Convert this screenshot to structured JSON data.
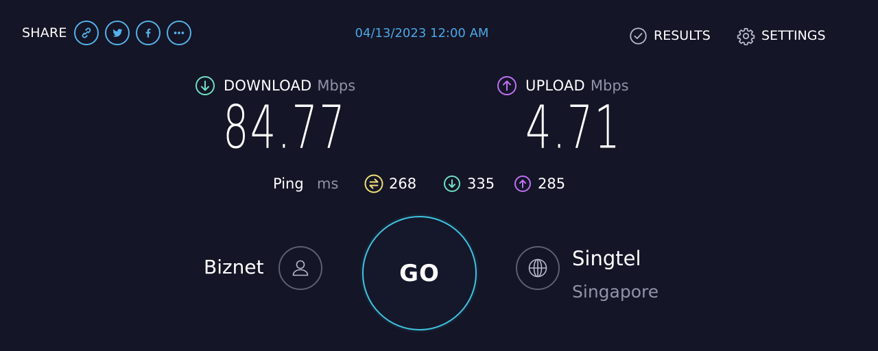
{
  "header": {
    "share_label": "SHARE",
    "share_buttons": [
      {
        "icon": "link-icon",
        "label": "link"
      },
      {
        "icon": "twitter-icon",
        "label": "twitter"
      },
      {
        "icon": "facebook-icon",
        "label": "facebook"
      },
      {
        "icon": "more-icon",
        "label": "more"
      }
    ],
    "timestamp": "04/13/2023 12:00 AM",
    "results_label": "RESULTS",
    "settings_label": "SETTINGS"
  },
  "download": {
    "title": "DOWNLOAD",
    "unit": "Mbps",
    "value": "84.77",
    "icon": "download-arrow-icon",
    "color": "#6fe1c5"
  },
  "upload": {
    "title": "UPLOAD",
    "unit": "Mbps",
    "value": "4.71",
    "icon": "upload-arrow-icon",
    "color": "#bf71f4"
  },
  "ping": {
    "label": "Ping",
    "unit": "ms",
    "idle": {
      "value": "268",
      "icon": "idle-latency-icon",
      "color": "#f1e07a"
    },
    "download": {
      "value": "335",
      "icon": "download-latency-icon",
      "color": "#6fe1c5"
    },
    "upload": {
      "value": "285",
      "icon": "upload-latency-icon",
      "color": "#bf71f4"
    }
  },
  "provider": {
    "name": "Biznet",
    "icon": "user-icon"
  },
  "go_button": {
    "label": "GO",
    "color": "#3fc3e0"
  },
  "server": {
    "name": "Singtel",
    "location": "Singapore",
    "icon": "globe-icon"
  },
  "colors": {
    "background": "#141526",
    "accent": "#55b2ea",
    "muted": "#9193a8"
  }
}
